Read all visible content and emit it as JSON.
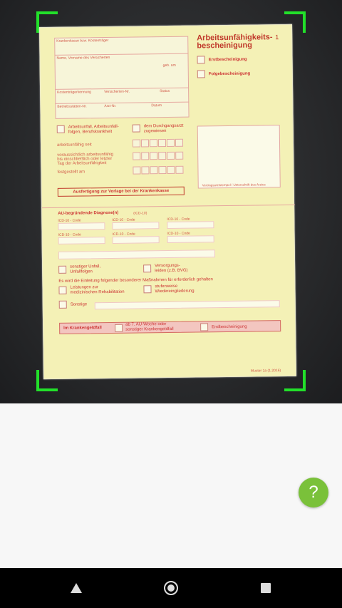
{
  "camera": {
    "document": {
      "title": "Arbeitsunfähigkeits-\nbescheinigung",
      "title_number": "1",
      "fields": {
        "krankenkasse": "Krankenkasse bzw. Kostenträger",
        "name": "Name, Vorname des Versicherten",
        "geb_am": "geb. am",
        "kostentraegerkennung": "Kostenträgerkennung",
        "versicherten_nr": "Versicherten-Nr.",
        "status": "Status",
        "betriebsstaetten_nr": "Betriebsstätten-Nr.",
        "arzt_nr": "Arzt-Nr.",
        "datum": "Datum"
      },
      "checkboxes": {
        "erstbescheinigung": "Erstbescheinigung",
        "folgebescheinigung": "Folgebescheinigung",
        "arbeitsunfall": "Arbeitsunfall, Arbeitsunfall-\nfolgen, Berufskrankheit",
        "durchgangsarzt": "dem Durchgangsarzt\nzugewiesen",
        "sonstiger_unfall": "sonstiger Unfall,\nUnfallfolgen",
        "versorgungsleiden": "Versorgungs-\nleiden (z.B. BVG)",
        "leistungen_reha": "Leistungen zur\nmedizinischen Rehabilitation",
        "wiedereingliederung": "stufenweise\nWiedereingliederung",
        "sonstige": "Sonstige"
      },
      "dates": {
        "au_seit": "arbeitsunfähig seit",
        "voraussichtlich": "voraussichtlich arbeitsunfähig\nbis einschließlich oder letzter\nTag der Arbeitsunfähigkeit",
        "festgestellt": "festgestellt am"
      },
      "stamp_caption": "Vertragsarztstempel / Unterschrift des Arztes",
      "ausfertigung": "Ausfertigung zur Vorlage bei der Krankenkasse",
      "diagnose_heading": "AU-begründende Diagnose(n)",
      "icd_suffix": "(ICD-10)",
      "icd_label": "ICD-10 - Code",
      "massnahmen": "Es wird die Einleitung folgender besonderer Maßnahmen für erforderlich gehalten",
      "banner": {
        "krankengeldfall": "Im Krankengeldfall",
        "ab_7": "ab 7. AU-Woche oder\nsonstiger Krankengeldfall",
        "endbescheinigung": "Endbescheinigung"
      },
      "muster": "Muster 1a (1.2016)"
    }
  },
  "help_button": {
    "label": "?"
  },
  "colors": {
    "accent": "#7ac13a",
    "scan_corners": "#22e02a",
    "form_red": "#c0392b"
  }
}
